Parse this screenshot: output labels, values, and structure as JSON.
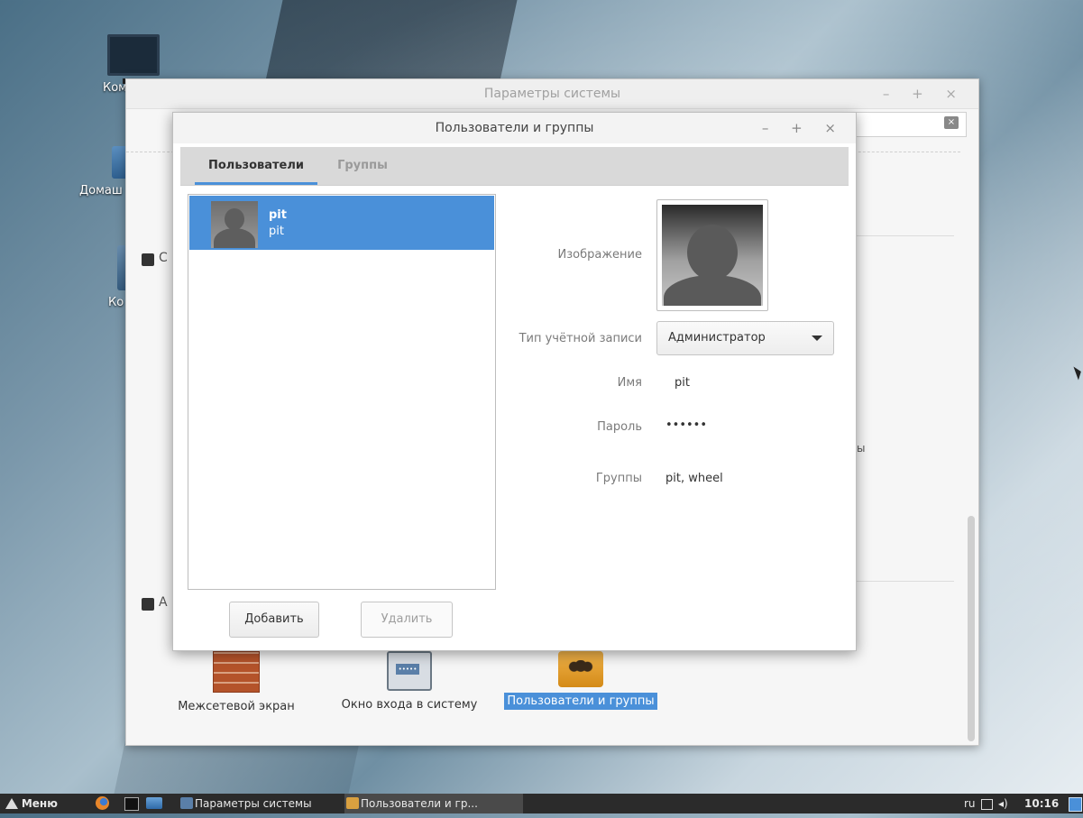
{
  "desktop": {
    "icons": [
      {
        "label": "Ком"
      },
      {
        "label": "Домаш"
      },
      {
        "label": "Ко"
      }
    ]
  },
  "parent_window": {
    "title": "Параметры системы",
    "controls": "– + ×",
    "peek_section1": "С",
    "peek_section2": "А",
    "peek_right": "ы",
    "tiles": [
      {
        "label": "Межсетевой экран",
        "icon": "firewall-icon"
      },
      {
        "label": "Окно входа в систему",
        "icon": "login-window-icon"
      },
      {
        "label": "Пользователи и группы",
        "icon": "users-groups-icon"
      }
    ]
  },
  "dialog": {
    "title": "Пользователи и группы",
    "controls": "– + ×",
    "tabs": [
      {
        "label": "Пользователи",
        "active": true
      },
      {
        "label": "Группы",
        "active": false
      }
    ],
    "users": [
      {
        "name": "pit",
        "login": "pit"
      }
    ],
    "buttons": {
      "add": "Добавить",
      "delete": "Удалить"
    },
    "details": {
      "image_label": "Изображение",
      "account_type_label": "Тип учётной записи",
      "account_type_value": "Администратор",
      "name_label": "Имя",
      "name_value": "pit",
      "password_label": "Пароль",
      "password_value": "••••••",
      "groups_label": "Группы",
      "groups_value": "pit, wheel"
    }
  },
  "taskbar": {
    "menu_label": "Меню",
    "tasks": [
      {
        "label": "Параметры системы"
      },
      {
        "label": "Пользователи и гр..."
      }
    ],
    "keyboard_layout": "ru",
    "clock": "10:16"
  },
  "colors": {
    "accent": "#4a90d9",
    "taskbar": "#2b2b2b"
  }
}
